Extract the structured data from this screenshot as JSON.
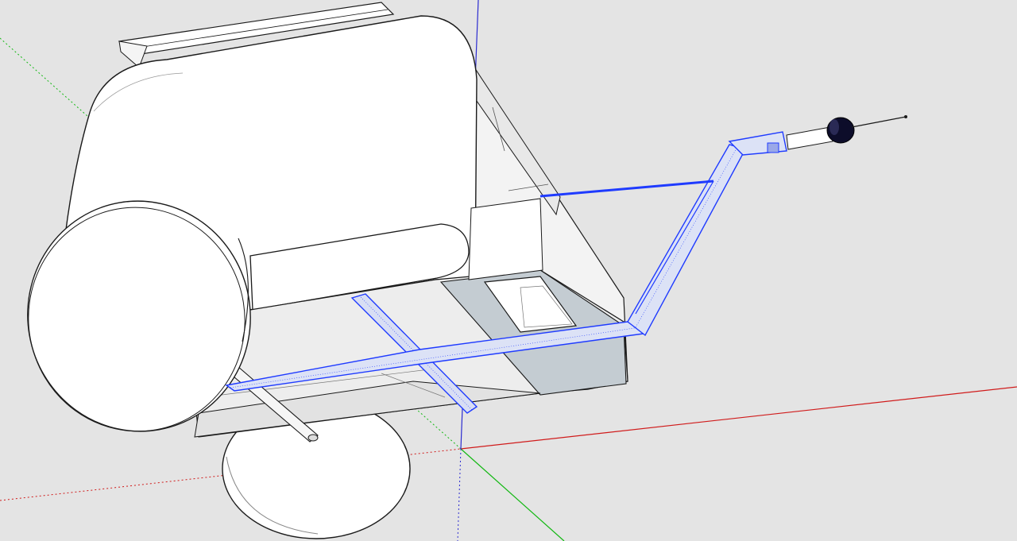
{
  "colors": {
    "background": "#e4e4e4",
    "edge": "#1a1a1a",
    "face": "#ffffff",
    "face_shade": "#d9dde0",
    "face_dark": "#b9c1c8",
    "selection": "#1f3bff",
    "axis_red": "#d01b1b",
    "axis_green": "#13b813",
    "axis_blue": "#2b2bd0"
  },
  "icons": {
    "axis_origin": "axis-origin-icon",
    "model": "bike-trailer-model"
  }
}
